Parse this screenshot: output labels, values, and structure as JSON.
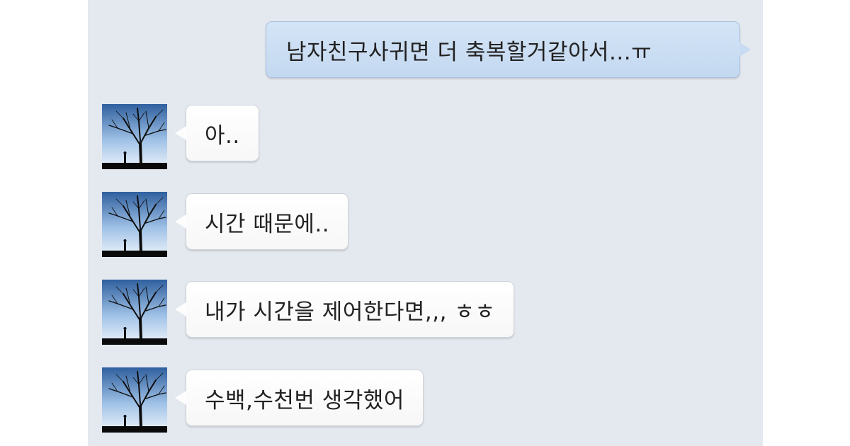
{
  "chat": {
    "background": "#e4e8ef",
    "outgoing": {
      "text": "남자친구사귀면 더 축복할거같아서...ㅠ",
      "bubble_color": "#c8dbf2"
    },
    "incoming": [
      {
        "text": "아.."
      },
      {
        "text": "시간 때문에.."
      },
      {
        "text": "내가 시간을 제어한다면,,, ㅎㅎ"
      },
      {
        "text": "수백,수천번 생각했어"
      }
    ],
    "avatar_icon": "tree-silhouette-avatar"
  }
}
